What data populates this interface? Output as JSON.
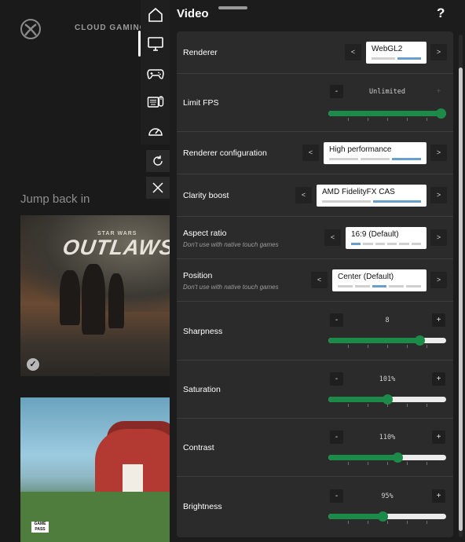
{
  "background": {
    "brand": "CLOUD GAMING",
    "section_title": "Jump back in",
    "tile1": {
      "title_top": "STAR WARS",
      "title_main": "OUTLAWS"
    },
    "tile2": {
      "badge": "GAME PASS"
    }
  },
  "rail": {
    "items": [
      {
        "name": "home",
        "icon": "home-icon"
      },
      {
        "name": "display",
        "icon": "monitor-icon",
        "active": true
      },
      {
        "name": "controller",
        "icon": "gamepad-icon"
      },
      {
        "name": "input",
        "icon": "keyboard-mouse-icon"
      },
      {
        "name": "stats",
        "icon": "speedometer-icon"
      }
    ],
    "reload_icon": "refresh-icon",
    "close_icon": "close-icon"
  },
  "panel": {
    "title": "Video",
    "help_label": "?",
    "settings": {
      "renderer": {
        "label": "Renderer",
        "value": "WebGL2",
        "option_count": 2,
        "selected_index": 1
      },
      "limit_fps": {
        "label": "Limit FPS",
        "value": "Unlimited",
        "fraction": 1.0
      },
      "renderer_config": {
        "label": "Renderer configuration",
        "value": "High performance",
        "option_count": 3,
        "selected_index": 2
      },
      "clarity_boost": {
        "label": "Clarity boost",
        "value": "AMD FidelityFX CAS",
        "option_count": 2,
        "selected_index": 1
      },
      "aspect_ratio": {
        "label": "Aspect ratio",
        "hint": "Don't use with native touch games",
        "value": "16:9 (Default)",
        "option_count": 6,
        "selected_index": 0
      },
      "position": {
        "label": "Position",
        "hint": "Don't use with native touch games",
        "value": "Center (Default)",
        "option_count": 5,
        "selected_index": 2
      },
      "sharpness": {
        "label": "Sharpness",
        "value": "8",
        "fraction": 0.8
      },
      "saturation": {
        "label": "Saturation",
        "value": "101%",
        "fraction": 0.5
      },
      "contrast": {
        "label": "Contrast",
        "value": "110%",
        "fraction": 0.6
      },
      "brightness": {
        "label": "Brightness",
        "value": "95%",
        "fraction": 0.46
      }
    },
    "prev_label": "<",
    "next_label": ">",
    "minus_label": "-",
    "plus_label": "+"
  },
  "colors": {
    "accent": "#1c8a48",
    "selected_tick": "#6a9ecd",
    "panel": "#2b2b2b"
  }
}
